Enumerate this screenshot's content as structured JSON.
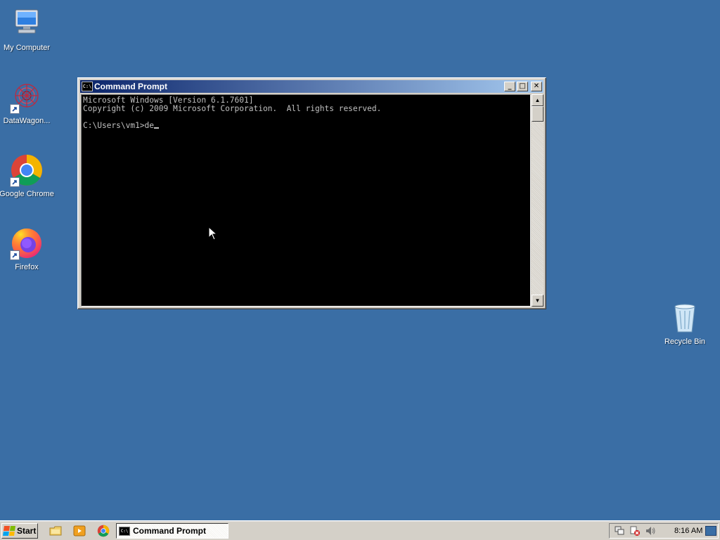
{
  "desktop": {
    "background": "#3a6ea5",
    "icons": [
      {
        "label": "My Computer",
        "icon": "computer-icon"
      },
      {
        "label": "DataWagon...",
        "icon": "datawagon-icon"
      },
      {
        "label": "Google Chrome",
        "icon": "chrome-icon"
      },
      {
        "label": "Firefox",
        "icon": "firefox-icon"
      },
      {
        "label": "Recycle Bin",
        "icon": "recycle-bin-icon"
      }
    ]
  },
  "window": {
    "title": "Command Prompt",
    "icon_text": "C:\\",
    "buttons": {
      "minimize": "_",
      "maximize": "□",
      "close": "✕"
    },
    "console_lines": [
      "Microsoft Windows [Version 6.1.7601]",
      "Copyright (c) 2009 Microsoft Corporation.  All rights reserved.",
      "",
      "C:\\Users\\vm1>de"
    ]
  },
  "taskbar": {
    "start_label": "Start",
    "quick_launch": [
      "explorer-icon",
      "media-player-icon",
      "chrome-icon"
    ],
    "task_items": [
      {
        "label": "Command Prompt",
        "icon": "cmd-icon"
      }
    ],
    "tray_icons": [
      "network-icon",
      "security-alert-icon",
      "volume-icon"
    ],
    "clock": "8:16 AM"
  }
}
